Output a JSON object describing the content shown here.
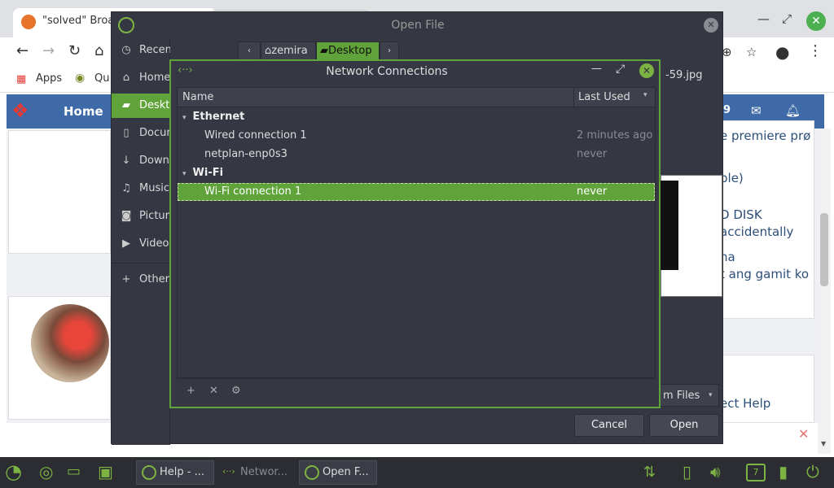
{
  "browser": {
    "tab_title": "\"solved\" Broa",
    "bookmarks": {
      "apps": "Apps",
      "qu": "Qu"
    },
    "site_home": "Home",
    "header_partial": "9",
    "right_snippets": [
      "e premiere prø",
      "ple)",
      "D DISK",
      "accidentally",
      "na",
      "t ang gamit ko",
      "ect Help"
    ]
  },
  "open_file": {
    "title": "Open File",
    "sidebar": [
      {
        "label": "Recent",
        "icon": "clock-icon"
      },
      {
        "label": "Home",
        "icon": "home-icon"
      },
      {
        "label": "Desktop",
        "icon": "folder-icon"
      },
      {
        "label": "Documents",
        "icon": "document-icon"
      },
      {
        "label": "Downloads",
        "icon": "download-icon"
      },
      {
        "label": "Music",
        "icon": "music-icon"
      },
      {
        "label": "Pictures",
        "icon": "camera-icon"
      },
      {
        "label": "Videos",
        "icon": "video-icon"
      },
      {
        "label": "Other Locations",
        "icon": "plus-icon"
      }
    ],
    "path": [
      "zemira",
      "Desktop"
    ],
    "visible_file": "-59.jpg",
    "filter": "m Files",
    "cancel": "Cancel",
    "open": "Open"
  },
  "network": {
    "title": "Network Connections",
    "col_name": "Name",
    "col_last_used": "Last Used",
    "groups": [
      {
        "name": "Ethernet",
        "items": [
          {
            "name": "Wired connection 1",
            "last_used": "2 minutes ago"
          },
          {
            "name": "netplan-enp0s3",
            "last_used": "never"
          }
        ]
      },
      {
        "name": "Wi-Fi",
        "items": [
          {
            "name": "Wi-Fi connection 1",
            "last_used": "never"
          }
        ]
      }
    ]
  },
  "taskbar": {
    "tasks": [
      "Help - ...",
      "Networ...",
      "Open F..."
    ],
    "badge": "7"
  },
  "colors": {
    "accent": "#5fa33a",
    "dialog_bg": "#353842",
    "taskbar_bg": "#2b2d33"
  }
}
